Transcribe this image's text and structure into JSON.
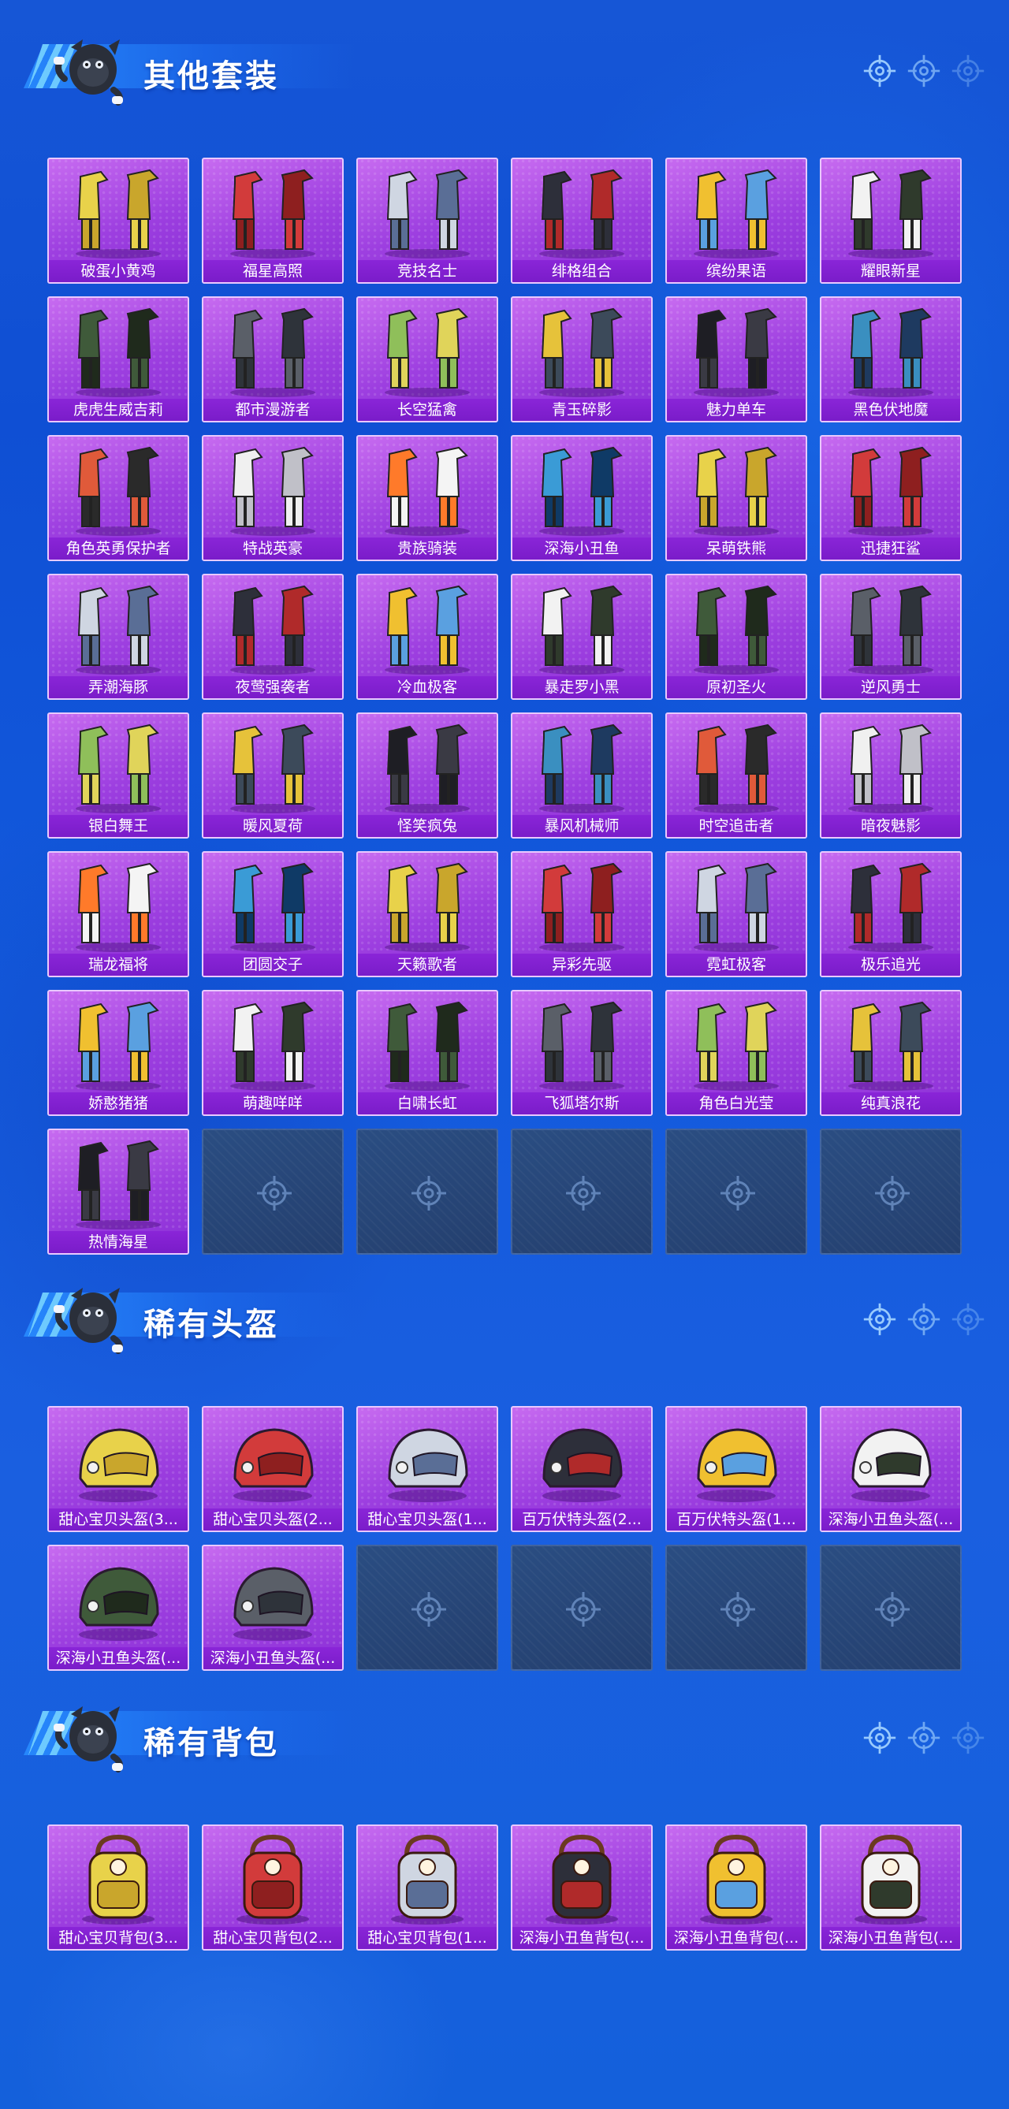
{
  "sections": [
    {
      "id": "outfits",
      "title": "其他套装",
      "items": [
        {
          "label": "破蛋小黄鸡",
          "icon": "chick-costume"
        },
        {
          "label": "福星高照",
          "icon": "red-suit"
        },
        {
          "label": "竞技名士",
          "icon": "white-jacket"
        },
        {
          "label": "绯格组合",
          "icon": "red-plaid-set"
        },
        {
          "label": "缤纷果语",
          "icon": "fruit-dress"
        },
        {
          "label": "耀眼新星",
          "icon": "white-shirt-set"
        },
        {
          "label": "虎虎生威吉莉",
          "icon": "red-tiger-suit"
        },
        {
          "label": "都市漫游者",
          "icon": "green-hoodie-set"
        },
        {
          "label": "长空猛禽",
          "icon": "grey-jacket-set"
        },
        {
          "label": "青玉碎影",
          "icon": "green-yellow-set"
        },
        {
          "label": "魅力单车",
          "icon": "yellow-shirt-set"
        },
        {
          "label": "黑色伏地魔",
          "icon": "black-hoodie-set"
        },
        {
          "label": "角色英勇保护者",
          "icon": "armor-robot"
        },
        {
          "label": "特战英豪",
          "icon": "tactical-vest"
        },
        {
          "label": "贵族骑装",
          "icon": "riding-coat"
        },
        {
          "label": "深海小丑鱼",
          "icon": "clownfish-suit"
        },
        {
          "label": "呆萌铁熊",
          "icon": "bear-suit"
        },
        {
          "label": "迅捷狂鲨",
          "icon": "shark-suit"
        },
        {
          "label": "弄潮海豚",
          "icon": "dolphin-jacket"
        },
        {
          "label": "夜莺强袭者",
          "icon": "black-leather-set"
        },
        {
          "label": "冷血极客",
          "icon": "cyber-suit"
        },
        {
          "label": "暴走罗小黑",
          "icon": "yellow-cat-suit"
        },
        {
          "label": "原初圣火",
          "icon": "dark-armor"
        },
        {
          "label": "逆风勇士",
          "icon": "blue-armor"
        },
        {
          "label": "银白舞王",
          "icon": "silver-suit"
        },
        {
          "label": "暖风夏荷",
          "icon": "white-lotus-dress"
        },
        {
          "label": "怪笑疯兔",
          "icon": "striped-suit"
        },
        {
          "label": "暴风机械师",
          "icon": "mechanic-suit"
        },
        {
          "label": "时空追击者",
          "icon": "red-mech-suit"
        },
        {
          "label": "暗夜魅影",
          "icon": "dark-teal-suit"
        },
        {
          "label": "瑞龙福将",
          "icon": "dragon-armor"
        },
        {
          "label": "团圆交子",
          "icon": "orange-dress"
        },
        {
          "label": "天籁歌者",
          "icon": "white-coat-set"
        },
        {
          "label": "异彩先驱",
          "icon": "purple-pattern-suit"
        },
        {
          "label": "霓虹极客",
          "icon": "neon-suit"
        },
        {
          "label": "极乐追光",
          "icon": "flower-shirt-set"
        },
        {
          "label": "娇憨猪猪",
          "icon": "pink-pig-set"
        },
        {
          "label": "萌趣咩咩",
          "icon": "sheep-set"
        },
        {
          "label": "白啸长虹",
          "icon": "white-black-suit"
        },
        {
          "label": "飞狐塔尔斯",
          "icon": "fox-jacket"
        },
        {
          "label": "角色白光莹",
          "icon": "character-dress"
        },
        {
          "label": "纯真浪花",
          "icon": "duck-set"
        },
        {
          "label": "热情海星",
          "icon": "starfish-shirt"
        }
      ],
      "empty_slots": 5
    },
    {
      "id": "helmets",
      "title": "稀有头盔",
      "items": [
        {
          "label": "甜心宝贝头盔(3...",
          "icon": "helmet-cupcake"
        },
        {
          "label": "甜心宝贝头盔(2...",
          "icon": "helmet-cake"
        },
        {
          "label": "甜心宝贝头盔(1...",
          "icon": "helmet-cake-red"
        },
        {
          "label": "百万伏特头盔(2...",
          "icon": "helmet-volt-grey"
        },
        {
          "label": "百万伏特头盔(1...",
          "icon": "helmet-volt-white"
        },
        {
          "label": "深海小丑鱼头盔(...",
          "icon": "helmet-clownfish"
        },
        {
          "label": "深海小丑鱼头盔(...",
          "icon": "helmet-clownfish-2"
        },
        {
          "label": "深海小丑鱼头盔(...",
          "icon": "helmet-clownfish-3"
        }
      ],
      "empty_slots": 4
    },
    {
      "id": "backpacks",
      "title": "稀有背包",
      "items": [
        {
          "label": "甜心宝贝背包(3...",
          "icon": "backpack-cake-brown"
        },
        {
          "label": "甜心宝贝背包(2...",
          "icon": "backpack-cake-cream"
        },
        {
          "label": "甜心宝贝背包(1...",
          "icon": "backpack-cake-red"
        },
        {
          "label": "深海小丑鱼背包(...",
          "icon": "backpack-clownfish"
        },
        {
          "label": "深海小丑鱼背包(...",
          "icon": "backpack-clownfish-2"
        },
        {
          "label": "深海小丑鱼背包(...",
          "icon": "backpack-clownfish-3"
        }
      ],
      "empty_slots": 0
    }
  ],
  "colors": {
    "card_bg": "#a449e3",
    "card_label_bg": "#7a1cc9",
    "empty_bg": "#27467a",
    "page_bg": "#1458d8"
  },
  "decor_icons": [
    "crosshair-icon",
    "crosshair-icon",
    "crosshair-icon"
  ]
}
